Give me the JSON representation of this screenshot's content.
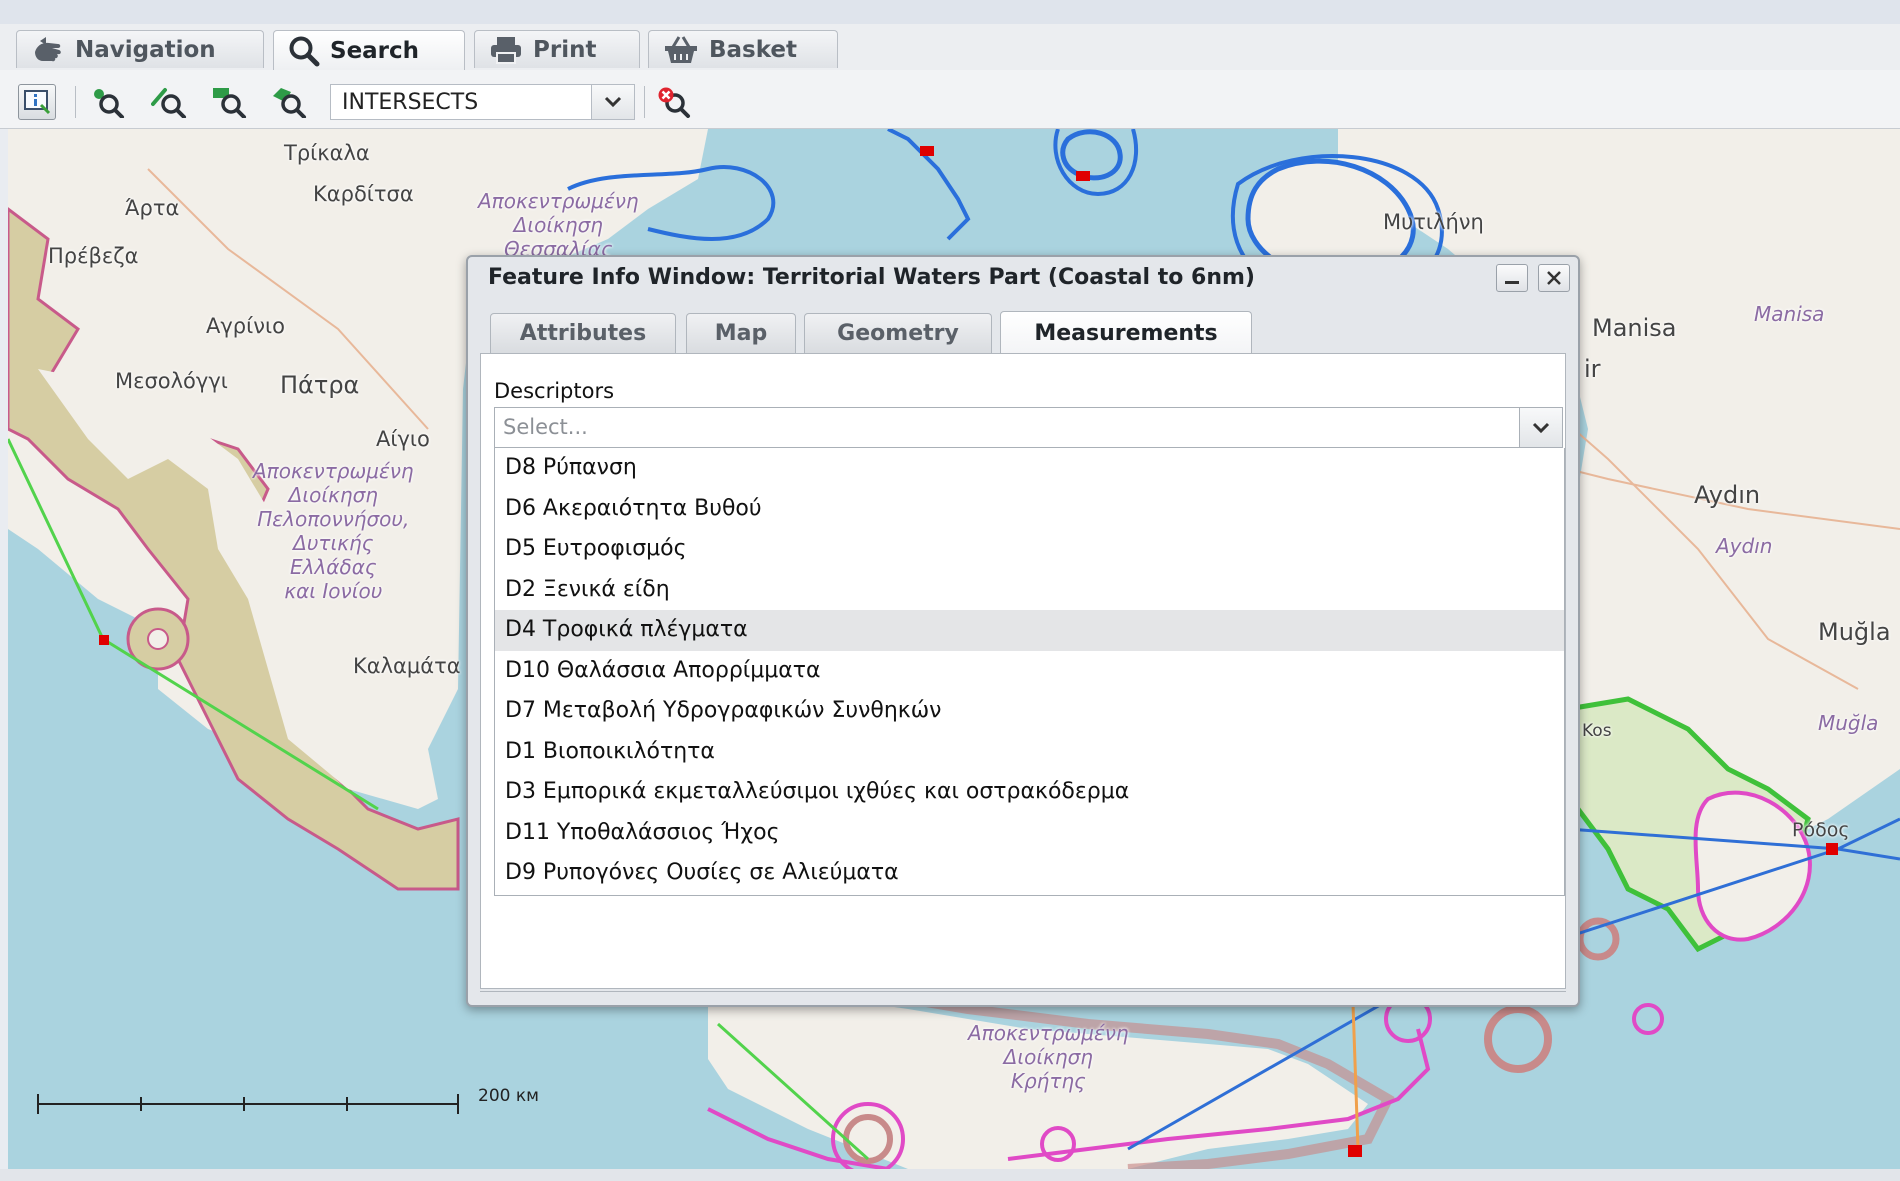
{
  "tabs": [
    {
      "id": "navigation",
      "label": "Navigation",
      "icon": "hand-icon",
      "active": false
    },
    {
      "id": "search",
      "label": "Search",
      "icon": "search-icon",
      "active": true
    },
    {
      "id": "print",
      "label": "Print",
      "icon": "printer-icon",
      "active": false
    },
    {
      "id": "basket",
      "label": "Basket",
      "icon": "basket-icon",
      "active": false
    }
  ],
  "toolbar": {
    "spatial_operator": "INTERSECTS",
    "tools": [
      "feature-info-icon",
      "select-point-icon",
      "select-line-icon",
      "select-box-icon",
      "select-polygon-icon",
      "clear-selection-icon"
    ]
  },
  "map": {
    "labels": {
      "trikala": "Τρίκαλα",
      "karditsa": "Καρδίτσα",
      "arta": "Άρτα",
      "preveza": "Πρέβεζα",
      "agrinio": "Αγρίνιο",
      "mesolongi": "Μεσολόγγι",
      "patra": "Πάτρα",
      "aigio": "Αίγιο",
      "kalamata": "Καλαμάτα",
      "mytilini": "Μυτιλήνη",
      "manisa": "Manisa",
      "manisa_region": "Manisa",
      "izmir_partial": "ir",
      "aydin": "Aydın",
      "aydin_region": "Aydın",
      "mugla": "Muğla",
      "mugla_region": "Muğla",
      "kos": "Kos",
      "rodos": "Ρόδος"
    },
    "regions": {
      "thessaly": [
        "Αποκεντρωμένη",
        "Διοίκηση",
        "Θεσσαλίας"
      ],
      "peloponnese": [
        "Αποκεντρωμένη",
        "Διοίκηση",
        "Πελοποννήσου,",
        "Δυτικής",
        "Ελλάδας",
        "και Ιονίου"
      ],
      "crete": [
        "Αποκεντρωμένη",
        "Διοίκηση",
        "Κρήτης"
      ]
    },
    "scale_label": "200 км",
    "colors": {
      "sea": "#aad3df",
      "land": "#f2efe9",
      "coastal_buffer": "#d6cda3",
      "blue_zone": "#2a6fdb",
      "pink_zone": "#e04ac6",
      "green_zone": "#3fc13a",
      "route_green": "#52d34c",
      "route_blue": "#2f6fd6",
      "route_orange": "#f0a04b",
      "marker_red": "#e00000"
    }
  },
  "dialog": {
    "title": "Feature Info Window: Territorial Waters Part (Coastal to 6nm)",
    "tabs": [
      {
        "label": "Attributes",
        "active": false
      },
      {
        "label": "Map",
        "active": false
      },
      {
        "label": "Geometry",
        "active": false
      },
      {
        "label": "Measurements",
        "active": true
      }
    ],
    "descriptors_label": "Descriptors",
    "select_placeholder": "Select...",
    "options": [
      "D8 Ρύπανση",
      "D6 Ακεραιότητα Βυθού",
      "D5 Ευτροφισμός",
      "D2 Ξενικά είδη",
      "D4 Τροφικά πλέγματα",
      "D10 Θαλάσσια Απορρίμματα",
      "D7 Μεταβολή Υδρογραφικών Συνθηκών",
      "D1 Βιοποικιλότητα",
      "D3 Εμπορικά εκμεταλλεύσιμοι ιχθύες και οστρακόδερμα",
      "D11 Υποθαλάσσιος Ήχος",
      "D9 Ρυπογόνες Ουσίες σε Αλιεύματα"
    ],
    "highlighted_option": "D4 Τροφικά πλέγματα"
  }
}
